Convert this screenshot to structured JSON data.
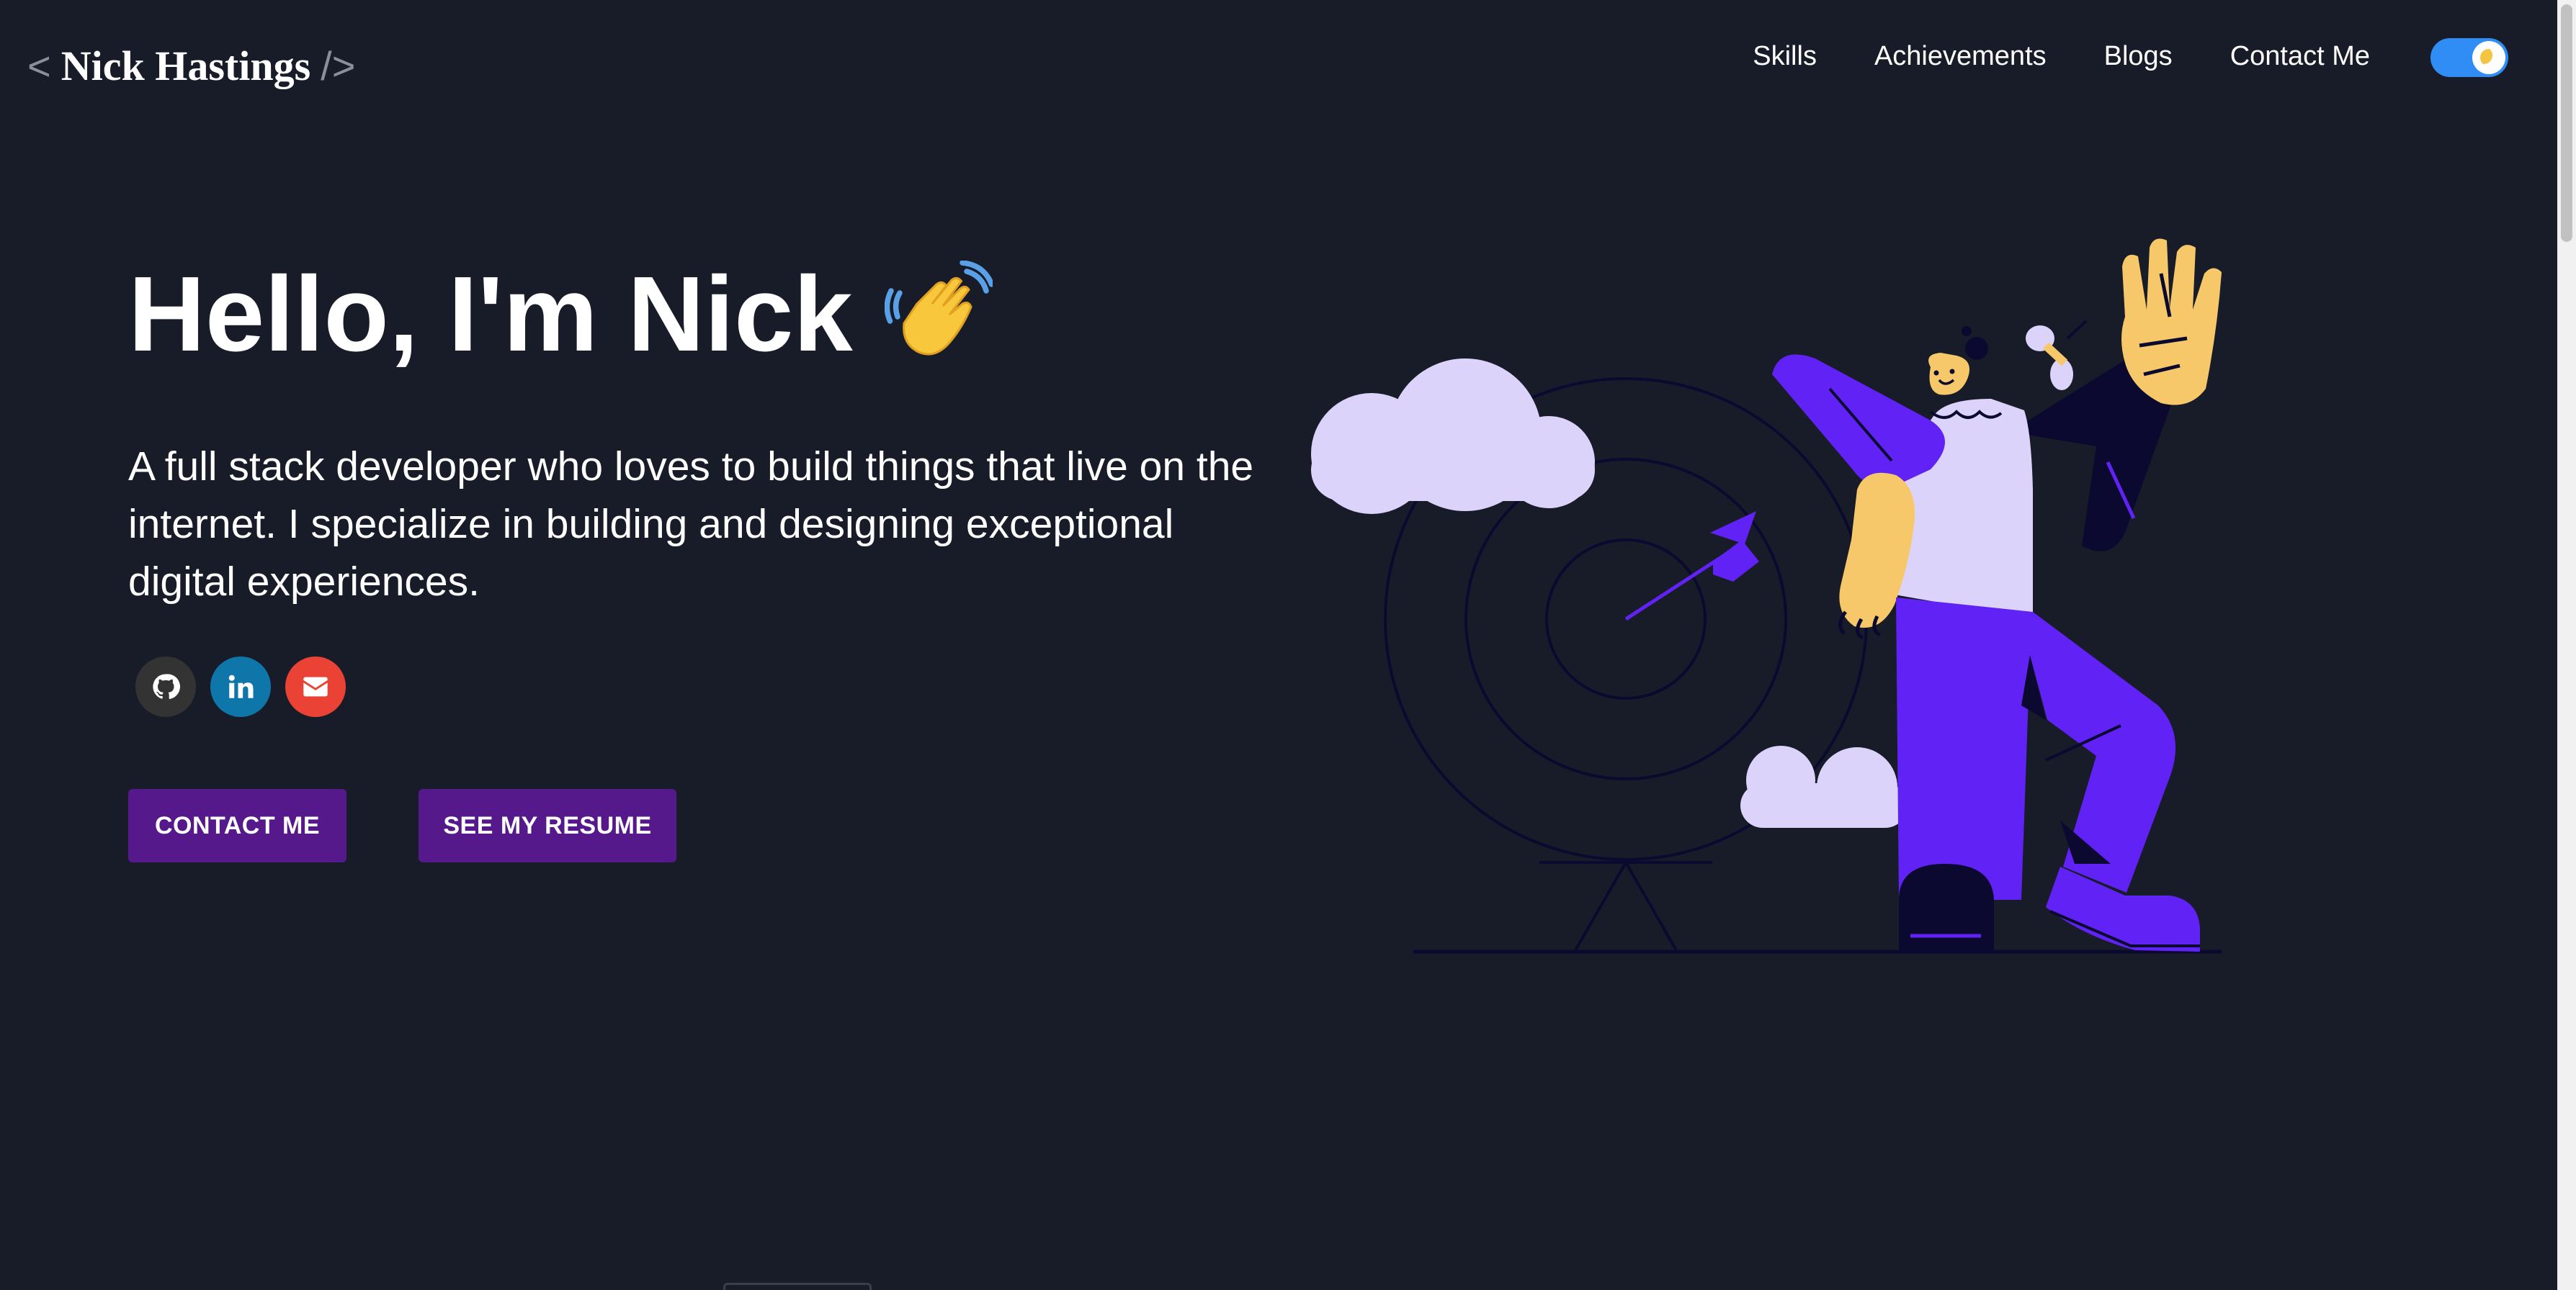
{
  "header": {
    "logo_open": "<",
    "logo_name": "Nick Hastings",
    "logo_close": "/>",
    "nav": [
      {
        "label": "Skills"
      },
      {
        "label": "Achievements"
      },
      {
        "label": "Blogs"
      },
      {
        "label": "Contact Me"
      }
    ],
    "theme_toggle": {
      "state": "on",
      "icon": "moon-icon"
    }
  },
  "hero": {
    "greeting": "Hello, I'm Nick",
    "greeting_emoji": "waving-hand-icon",
    "intro": "A full stack developer who loves to build things that live on the internet. I specialize in building and designing exceptional digital experiences.",
    "socials": [
      {
        "name": "github-icon"
      },
      {
        "name": "linkedin-icon"
      },
      {
        "name": "mail-icon"
      }
    ],
    "buttons": {
      "contact": "CONTACT ME",
      "resume": "SEE MY RESUME"
    },
    "illustration": "developer-target-illustration"
  },
  "colors": {
    "background": "#171c28",
    "button": "#55198b",
    "toggle": "#2f8df5",
    "github": "#333333",
    "linkedin": "#0e76a8",
    "mail": "#ea4335",
    "illustration_purple": "#6122f5",
    "illustration_lavender": "#dcd3fb",
    "illustration_skin": "#f7c86a",
    "illustration_dark": "#0b0930"
  }
}
